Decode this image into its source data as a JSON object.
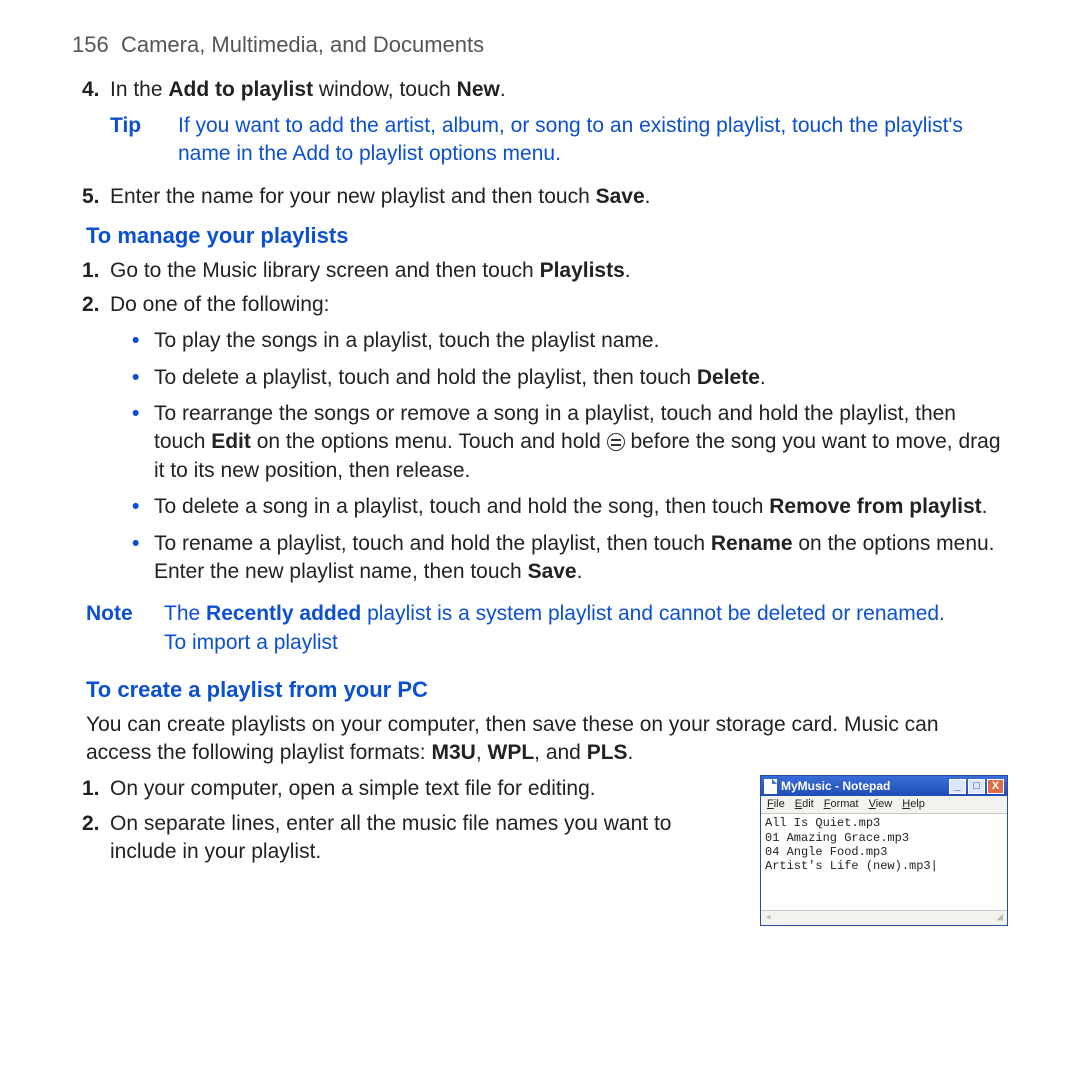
{
  "header": {
    "page_number": "156",
    "chapter": "Camera, Multimedia, and Documents"
  },
  "intro": {
    "step4": {
      "num": "4.",
      "pre": "In the ",
      "bold1": "Add to playlist",
      "mid": " window, touch ",
      "bold2": "New",
      "post": "."
    },
    "tip": {
      "label": "Tip",
      "text": "If you want to add the artist, album, or song to an existing playlist, touch the playlist's name in the Add to playlist options menu."
    },
    "step5": {
      "num": "5.",
      "pre": "Enter the name for your new playlist and then touch ",
      "bold1": "Save",
      "post": "."
    }
  },
  "manage": {
    "heading": "To manage your playlists",
    "step1": {
      "num": "1.",
      "pre": "Go to the Music library screen and then touch ",
      "bold1": "Playlists",
      "post": "."
    },
    "step2": {
      "num": "2.",
      "text": "Do one of the following:"
    },
    "bullets": {
      "b1": "To play the songs in a playlist, touch the playlist name.",
      "b2": {
        "pre": "To delete a playlist, touch and hold the playlist, then touch ",
        "bold1": "Delete",
        "post": "."
      },
      "b3": {
        "pre": "To rearrange the songs or remove a song in a playlist, touch and hold the playlist, then touch ",
        "bold1": "Edit",
        "mid": " on the options menu. Touch and hold ",
        "post": " before the song you want to move, drag it to its new position, then release."
      },
      "b4": {
        "pre": "To delete a song in a playlist, touch and hold the song, then touch ",
        "bold1": "Remove from playlist",
        "post": "."
      },
      "b5": {
        "pre": "To rename a playlist, touch and hold the playlist, then touch ",
        "bold1": "Rename",
        "mid": " on the options menu. Enter the new playlist name, then touch ",
        "bold2": "Save",
        "post": "."
      }
    },
    "note": {
      "label": "Note",
      "pre": "The ",
      "bold1": "Recently added",
      "mid": " playlist is a system playlist and cannot be deleted or renamed. ",
      "line2": "To import a playlist"
    }
  },
  "create_pc": {
    "heading": "To create a playlist from your PC",
    "intro": {
      "pre": "You can create playlists on your computer, then save these on your storage card. Music can access the following playlist formats: ",
      "f1": "M3U",
      "sep1": ", ",
      "f2": "WPL",
      "sep2": ", and ",
      "f3": "PLS",
      "post": "."
    },
    "step1": {
      "num": "1.",
      "text": "On your computer, open a simple text file for editing."
    },
    "step2": {
      "num": "2.",
      "text": "On separate lines, enter all the music file names you want to include in your playlist."
    }
  },
  "notepad": {
    "title": "MyMusic - Notepad",
    "menu": {
      "file": "File",
      "edit": "Edit",
      "format": "Format",
      "view": "View",
      "help": "Help"
    },
    "content": "All Is Quiet.mp3\n01 Amazing Grace.mp3\n04 Angle Food.mp3\nArtist's Life (new).mp3|",
    "btn_min": "_",
    "btn_max": "□",
    "btn_close": "X"
  }
}
